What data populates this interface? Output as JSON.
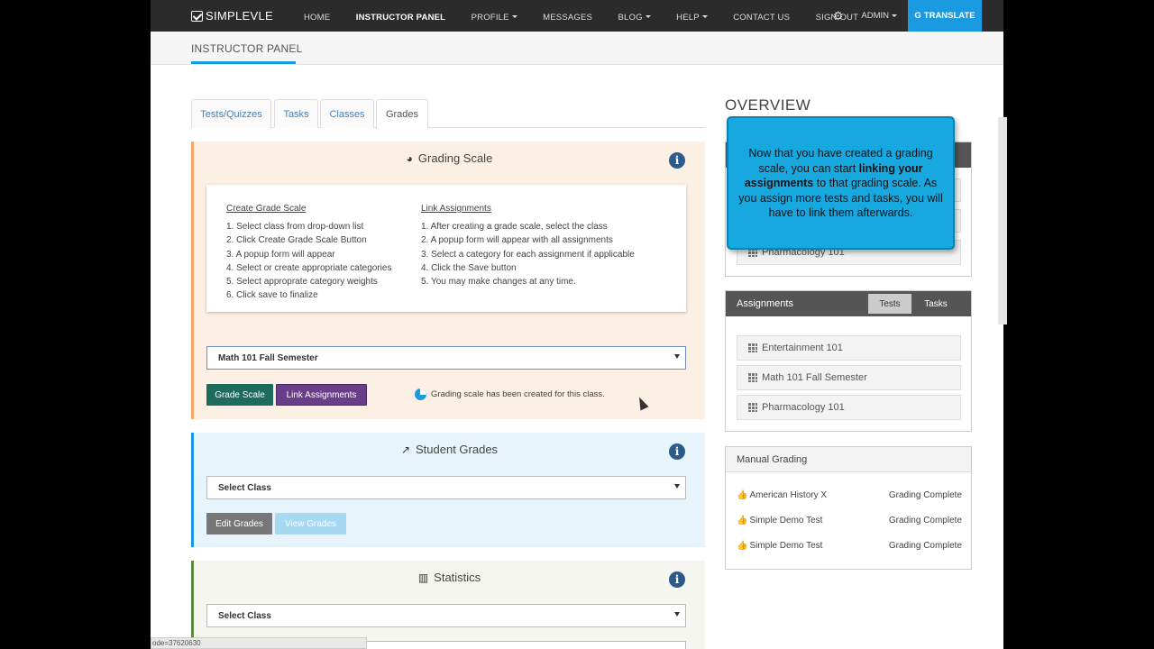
{
  "navbar": {
    "brand": "SIMPLEVLE",
    "items": [
      {
        "label": "HOME",
        "active": false
      },
      {
        "label": "INSTRUCTOR PANEL",
        "active": true
      },
      {
        "label": "PROFILE",
        "dropdown": true
      },
      {
        "label": "MESSAGES"
      },
      {
        "label": "BLOG",
        "dropdown": true
      },
      {
        "label": "HELP",
        "dropdown": true
      },
      {
        "label": "CONTACT US"
      },
      {
        "label": "SIGN OUT"
      }
    ],
    "admin": "ADMIN",
    "translate": "TRANSLATE",
    "translate_g": "G"
  },
  "subheader": {
    "title": "INSTRUCTOR PANEL"
  },
  "tabs": [
    {
      "label": "Tests/Quizzes"
    },
    {
      "label": "Tasks"
    },
    {
      "label": "Classes"
    },
    {
      "label": "Grades",
      "active": true
    }
  ],
  "grading": {
    "title": "Grading Scale",
    "create_heading": "Create Grade Scale",
    "create_steps": [
      "1. Select class from drop-down list",
      "2. Click Create Grade Scale Button",
      "3. A popup form will appear",
      "4. Select or create appropriate categories",
      "5. Select approprate category weights",
      "6. Click save to finalize"
    ],
    "link_heading": "Link Assignments",
    "link_steps": [
      "1. After creating a grade scale, select the class",
      "2. A popup form will appear with all assignments",
      "3. Select a category for each assignment if applicable",
      "4. Click the Save button",
      "5. You may make changes at any time."
    ],
    "selected_class": "Math 101 Fall Semester",
    "grade_scale_btn": "Grade Scale",
    "link_btn": "Link Assignments",
    "status": "Grading scale has been created for this class."
  },
  "student_grades": {
    "title": "Student Grades",
    "select": "Select Class",
    "edit_btn": "Edit Grades",
    "view_btn": "View Grades"
  },
  "statistics": {
    "title": "Statistics",
    "select": "Select Class"
  },
  "overview": {
    "title": "OVERVIEW",
    "classes_last": "Pharmacology 101"
  },
  "assignments": {
    "title": "Assignments",
    "tab_tests": "Tests",
    "tab_tasks": "Tasks",
    "items": [
      "Entertainment 101",
      "Math 101 Fall Semester",
      "Pharmacology 101"
    ]
  },
  "manual": {
    "title": "Manual Grading",
    "rows": [
      {
        "name": "American History X",
        "status": "Grading Complete"
      },
      {
        "name": "Simple Demo Test",
        "status": "Grading Complete"
      },
      {
        "name": "Simple Demo Test",
        "status": "Grading Complete"
      }
    ]
  },
  "tooltip": {
    "before": "Now that you have created a grading scale, you can start",
    "bold": "linking your assignments",
    "after": "to that grading scale. As you assign more tests and tasks, you will have to link them afterwards."
  },
  "statusbar": "ode=37620630",
  "colors": {
    "nav_bg": "#2b2b2b",
    "accent": "#1a9ae0",
    "grade_btn": "#1d6b5a",
    "link_btn": "#6a3d8a",
    "edit_btn": "#777777",
    "view_btn": "#a7d8f2"
  }
}
